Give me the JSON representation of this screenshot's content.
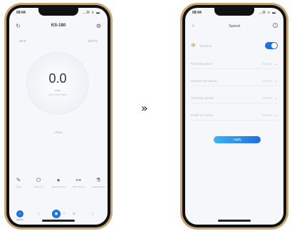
{
  "left_phone": {
    "status": {
      "time": "09:04",
      "icons": "..ll ≈ ▬"
    },
    "header": {
      "title": "KS-180",
      "left_icon": "refresh-icon",
      "right_icon": "gear-icon"
    },
    "temps": {
      "left": "25°C",
      "right": "24.6°C"
    },
    "dial": {
      "value": "0.0",
      "unit": "l/min",
      "sub": "Inlet Flow Power"
    },
    "flow_label": "LPD-F",
    "controls": [
      {
        "icon": "brush-icon",
        "label": "Light"
      },
      {
        "icon": "power-icon",
        "label": "Power On"
      },
      {
        "icon": "fan-icon",
        "label": "Speed Setting"
      },
      {
        "icon": "valve-icon",
        "label": "Valve Control"
      },
      {
        "icon": "flask-icon",
        "label": "Coating Mode"
      }
    ],
    "pager": {
      "count": 3,
      "active": 1
    },
    "nav": [
      {
        "icon": "home-icon",
        "label": "Device"
      },
      {
        "icon": "cube-icon",
        "label": ""
      },
      {
        "icon": "app-icon",
        "label": ""
      },
      {
        "icon": "diamond-icon",
        "label": ""
      },
      {
        "icon": "doc-icon",
        "label": ""
      }
    ]
  },
  "separator": "»",
  "right_phone": {
    "status": {
      "time": "09:04",
      "icons": "..ll ≈ ▬"
    },
    "header": {
      "title": "Speed",
      "back_icon": "back-icon",
      "help_icon": "help-icon"
    },
    "toggle": {
      "label": "Variation",
      "on": true
    },
    "settings": [
      {
        "label": "First time period",
        "value": "Choose"
      },
      {
        "label": "Second time period",
        "value": "Choose"
      },
      {
        "label": "Third time period",
        "value": "Choose"
      },
      {
        "label": "Inside CO check",
        "value": "Choose"
      }
    ],
    "apply_label": "Apply"
  },
  "colors": {
    "accent": "#1e6fe0",
    "frame": "#c9a574",
    "fan": "#e39b2c"
  }
}
